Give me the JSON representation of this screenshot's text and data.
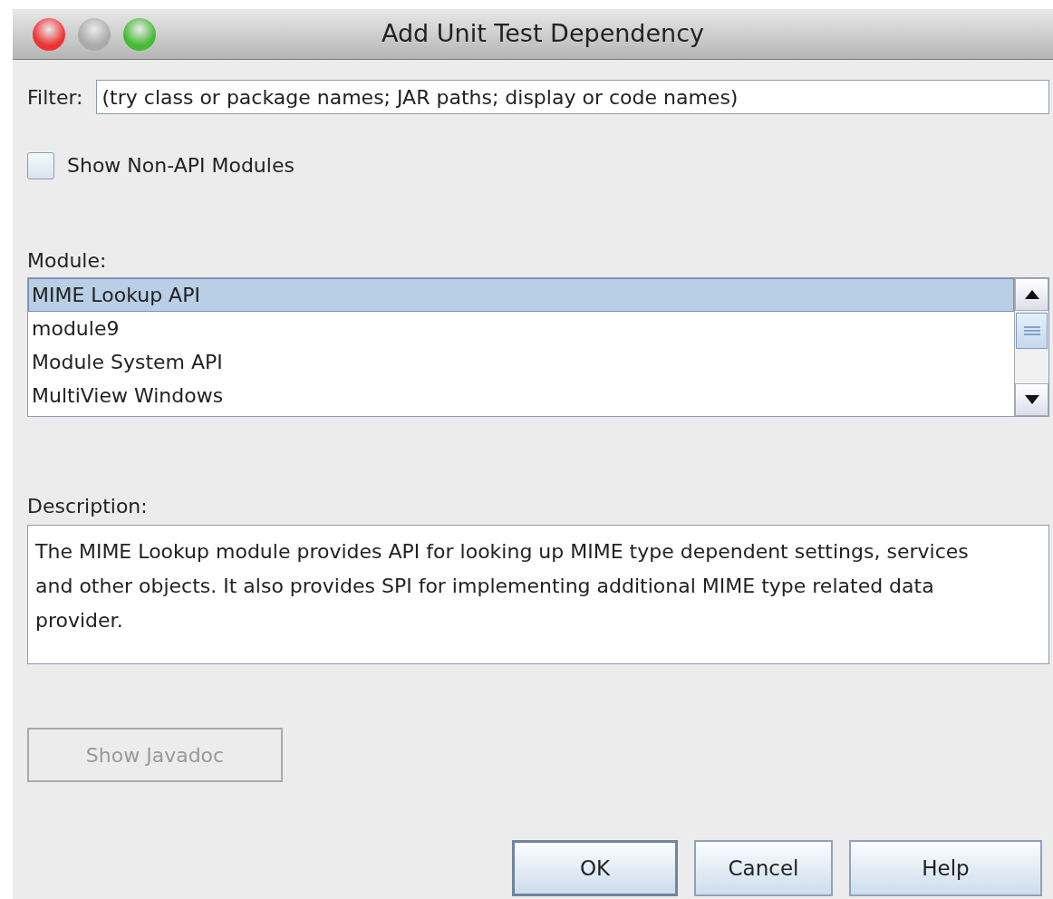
{
  "window": {
    "title": "Add Unit Test Dependency"
  },
  "filter": {
    "label": "Filter:",
    "placeholder": "(try class or package names; JAR paths; display or code names)"
  },
  "show_non_api": {
    "label": "Show Non-API Modules",
    "checked": false
  },
  "module": {
    "label": "Module:",
    "items": [
      {
        "text": "MIME Lookup API",
        "selected": true
      },
      {
        "text": "module9",
        "selected": false
      },
      {
        "text": "Module System API",
        "selected": false
      },
      {
        "text": "MultiView Windows",
        "selected": false
      }
    ]
  },
  "description": {
    "label": "Description:",
    "text": "The MIME Lookup module provides API for looking up MIME type dependent settings, services and other objects. It also provides SPI for implementing additional MIME type related data provider."
  },
  "javadoc_button": {
    "label": "Show Javadoc",
    "disabled": true
  },
  "buttons": [
    {
      "label": "OK",
      "default": true
    },
    {
      "label": "Cancel",
      "default": false
    },
    {
      "label": "Help",
      "default": false
    }
  ]
}
